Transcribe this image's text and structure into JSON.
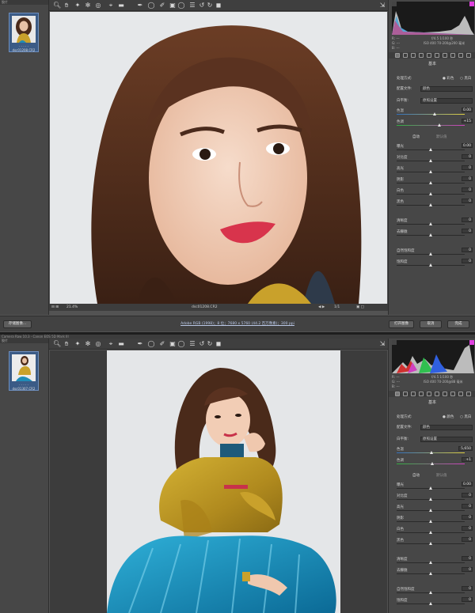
{
  "shot1": {
    "filmstrip": {
      "header": "胶片",
      "thumb_stars": "· · · · ·",
      "thumb_name": "dsc01208.CR2"
    },
    "histogram_meta": {
      "line1_left": "R: ---",
      "line1_right": "f/4.5   1/100 秒",
      "line2_left": "G: ---",
      "line2_right": "ISO 400   70-200@200 毫米",
      "line3_left": "B: ---"
    },
    "panel": {
      "title": "基本",
      "treatment_label": "处理方式:",
      "treatment_color": "彩色",
      "treatment_bw": "黑白",
      "profile_label": "配置文件:",
      "profile_value": "颜色",
      "wb_label": "白平衡:",
      "wb_value": "原照设置",
      "temp": {
        "label": "色温",
        "value": "0.00"
      },
      "tint": {
        "label": "色调",
        "value": "+15"
      },
      "auto": "自动",
      "default": "默认值",
      "sliders": [
        {
          "label": "曝光",
          "value": "0.00",
          "pos": 0.5
        },
        {
          "label": "对比度",
          "value": "0",
          "pos": 0.5
        },
        {
          "label": "高光",
          "value": "0",
          "pos": 0.5
        },
        {
          "label": "阴影",
          "value": "0",
          "pos": 0.5
        },
        {
          "label": "白色",
          "value": "0",
          "pos": 0.5
        },
        {
          "label": "黑色",
          "value": "0",
          "pos": 0.5
        },
        {
          "label": "清晰度",
          "value": "0",
          "pos": 0.5
        },
        {
          "label": "去朦胧",
          "value": "0",
          "pos": 0.5
        },
        {
          "label": "自然饱和度",
          "value": "0",
          "pos": 0.5
        },
        {
          "label": "饱和度",
          "value": "0",
          "pos": 0.5
        }
      ]
    },
    "status": {
      "zoom": "21.4%",
      "filename": "dsc01208.CR2",
      "page": "1/1"
    },
    "bottom": {
      "save": "存储图像...",
      "info": "Adobe RGB (1998)；8 位；7680 x 5760 (44.2 百万像素)；300 ppi",
      "open": "打开图像",
      "cancel": "取消",
      "done": "完成"
    }
  },
  "shot2": {
    "title": "Camera Raw 10.3 - Canon EOS 5D Mark III",
    "filmstrip": {
      "header": "胶片",
      "thumb_stars": "· · · · ·",
      "thumb_name": "dsc01307.CR2"
    },
    "histogram_meta": {
      "line1_left": "R: ---",
      "line1_right": "f/4.5   1/100 秒",
      "line2_left": "G: ---",
      "line2_right": "ISO 400   70-200@88 毫米",
      "line3_left": "B: ---"
    },
    "panel": {
      "title": "基本",
      "treatment_label": "处理方式:",
      "treatment_color": "颜色",
      "treatment_bw": "黑白",
      "profile_label": "配置文件:",
      "profile_value": "颜色",
      "wb_label": "白平衡:",
      "wb_value": "原照设置",
      "temp": {
        "label": "色温",
        "value": "5,650"
      },
      "tint": {
        "label": "色调",
        "value": "+1"
      },
      "auto": "自动",
      "default": "默认值",
      "sliders": [
        {
          "label": "曝光",
          "value": "0.00",
          "pos": 0.5
        },
        {
          "label": "对比度",
          "value": "0",
          "pos": 0.5
        },
        {
          "label": "高光",
          "value": "0",
          "pos": 0.5
        },
        {
          "label": "阴影",
          "value": "0",
          "pos": 0.5
        },
        {
          "label": "白色",
          "value": "0",
          "pos": 0.5
        },
        {
          "label": "黑色",
          "value": "0",
          "pos": 0.5
        },
        {
          "label": "清晰度",
          "value": "0",
          "pos": 0.5
        },
        {
          "label": "去朦胧",
          "value": "0",
          "pos": 0.5
        },
        {
          "label": "自然饱和度",
          "value": "0",
          "pos": 0.5
        },
        {
          "label": "饱和度",
          "value": "0",
          "pos": 0.5
        }
      ]
    }
  },
  "tools": [
    "zoom-icon",
    "hand-icon",
    "white-balance-icon",
    "color-sampler-icon",
    "targeted-adjust-icon",
    "crop-icon",
    "straighten-icon",
    "spot-removal-icon",
    "redeye-icon",
    "adjustment-brush-icon",
    "graduated-filter-icon",
    "radial-filter-icon",
    "preferences-icon",
    "rotate-ccw-icon",
    "rotate-cw-icon",
    "trash-icon"
  ],
  "colors": {
    "panel": "#474747",
    "canvas": "#4a4a4a",
    "accent": "#3b5b86",
    "clip_magenta": "#e040e0"
  }
}
